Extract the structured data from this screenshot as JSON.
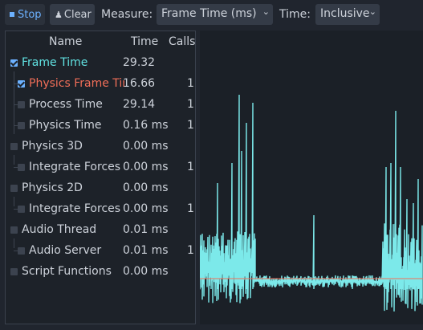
{
  "toolbar": {
    "stop_label": "Stop",
    "clear_label": "Clear",
    "measure_label": "Measure:",
    "measure_value": "Frame Time (ms)",
    "time_label": "Time:",
    "time_value": "Inclusive"
  },
  "tree": {
    "headers": {
      "name": "Name",
      "time": "Time",
      "calls": "Calls"
    },
    "rows": [
      {
        "name": "Frame Time",
        "time": "29.32",
        "calls": "",
        "checked": true,
        "color": "#60e0e0"
      },
      {
        "name": "Physics Frame Time",
        "time": "16.66",
        "calls": "1",
        "checked": true,
        "color": "#f06e58"
      },
      {
        "name": "Process Time",
        "time": "29.14",
        "calls": "1",
        "checked": false,
        "color": ""
      },
      {
        "name": "Physics Time",
        "time": "0.16 ms",
        "calls": "1",
        "checked": false,
        "color": ""
      },
      {
        "name": "Physics 3D",
        "time": "0.00 ms",
        "calls": "",
        "checked": false,
        "color": ""
      },
      {
        "name": "Integrate Forces",
        "time": "0.00 ms",
        "calls": "1",
        "checked": false,
        "color": ""
      },
      {
        "name": "Physics 2D",
        "time": "0.00 ms",
        "calls": "",
        "checked": false,
        "color": ""
      },
      {
        "name": "Integrate Forces",
        "time": "0.00 ms",
        "calls": "1",
        "checked": false,
        "color": ""
      },
      {
        "name": "Audio Thread",
        "time": "0.01 ms",
        "calls": "",
        "checked": false,
        "color": ""
      },
      {
        "name": "Audio Server",
        "time": "0.01 ms",
        "calls": "1",
        "checked": false,
        "color": ""
      },
      {
        "name": "Script Functions",
        "time": "0.00 ms",
        "calls": "",
        "checked": false,
        "color": ""
      }
    ]
  },
  "colors": {
    "frame_time_series": "#7ce9ea",
    "physics_frame_series": "#f06e58",
    "accent": "#6cb1ff"
  },
  "icons": {
    "stop": "stop-square-icon",
    "clear": "broom-icon",
    "dropdown": "chevron-down-icon"
  }
}
